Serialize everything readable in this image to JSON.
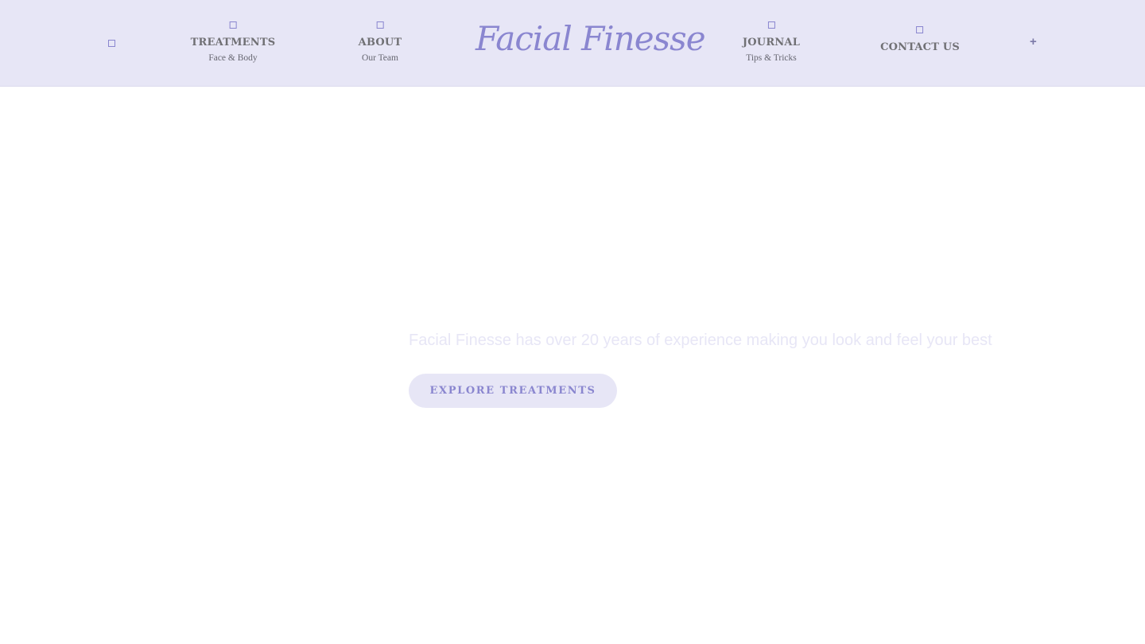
{
  "header": {
    "logo": "Facial Finesse",
    "plus": "+",
    "nav": [
      {
        "label": "TREATMENTS",
        "sub": "Face & Body",
        "icon": "square-icon"
      },
      {
        "label": "ABOUT",
        "sub": "Our Team",
        "icon": "square-icon"
      },
      {
        "label": "JOURNAL",
        "sub": "Tips & Tricks",
        "icon": "square-icon"
      },
      {
        "label": "CONTACT US",
        "icon": "square-icon"
      }
    ]
  },
  "hero": {
    "tagline": "Facial Finesse has over 20 years of experience making you look and feel your best",
    "cta_label": "EXPLORE TREATMENTS"
  },
  "colors": {
    "header_bg": "#e7e6f6",
    "accent": "#8a86cf",
    "nav_text": "#707074"
  }
}
